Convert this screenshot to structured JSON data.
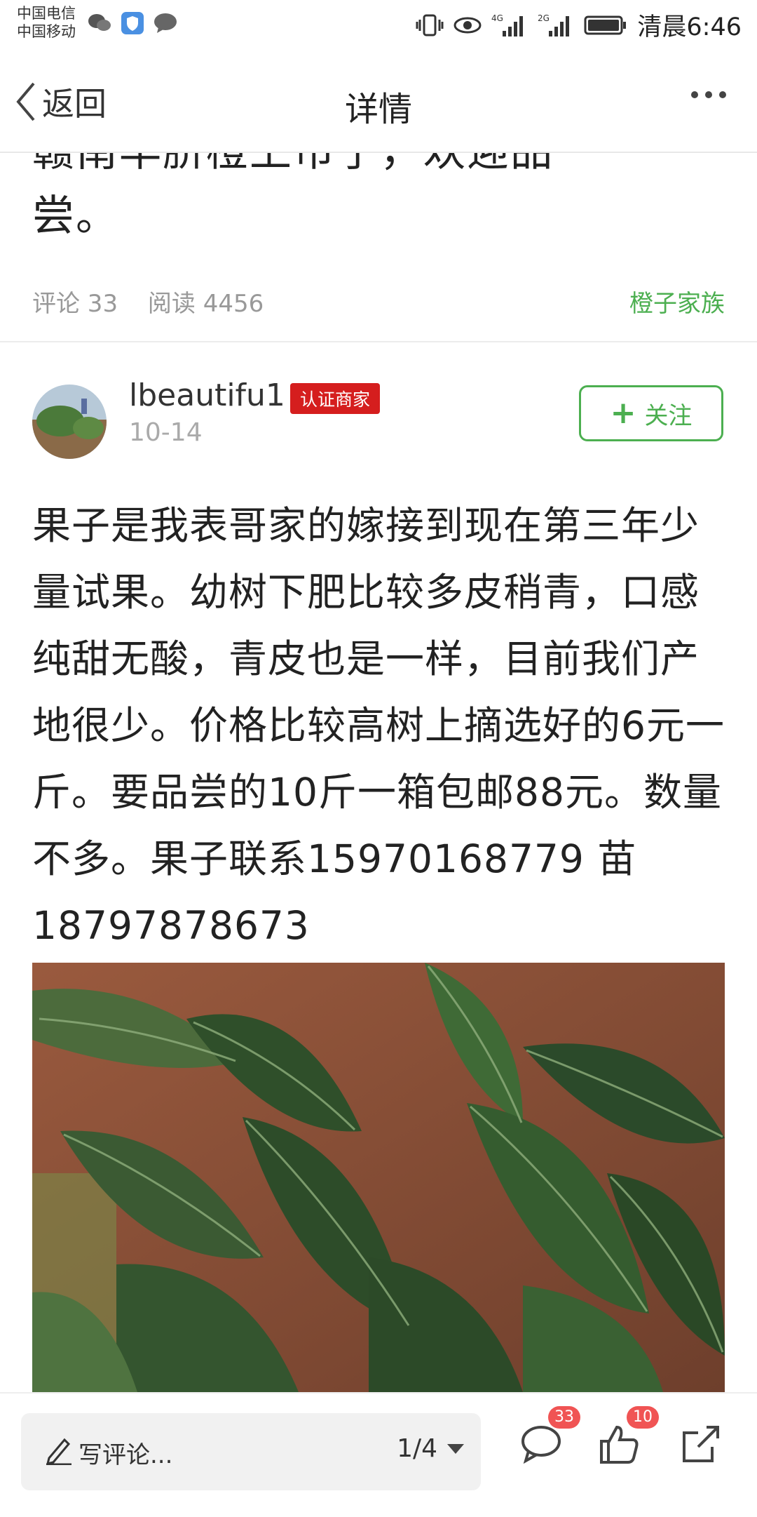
{
  "status_bar": {
    "carrier_1": "中国电信",
    "carrier_2": "中国移动",
    "network_1": "4G",
    "network_2": "2G",
    "time": "清晨6:46"
  },
  "nav": {
    "back_label": "返回",
    "title": "详情"
  },
  "post": {
    "title_line_1": "赣南早脐橙上市了，欢迎品",
    "title_line_2": "尝。",
    "comments_label": "评论 33",
    "reads_label": "阅读 4456",
    "group": "橙子家族"
  },
  "author": {
    "name": "lbeautifu1",
    "badge": "认证商家",
    "date": "10-14",
    "follow_label": "关注"
  },
  "content": {
    "text": "果子是我表哥家的嫁接到现在第三年少量试果。幼树下肥比较多皮稍青，口感纯甜无酸，青皮也是一样，目前我们产地很少。价格比较高树上摘选好的6元一斤。要品尝的10斤一箱包邮88元。数量不多。果子联系15970168779  苗18797878673"
  },
  "bottom_bar": {
    "comment_placeholder": "写评论...",
    "page_indicator": "1/4",
    "comment_count": "33",
    "like_count": "10"
  },
  "colors": {
    "accent_green": "#4caf50",
    "badge_red": "#d51e1e",
    "count_red": "#f05454"
  }
}
